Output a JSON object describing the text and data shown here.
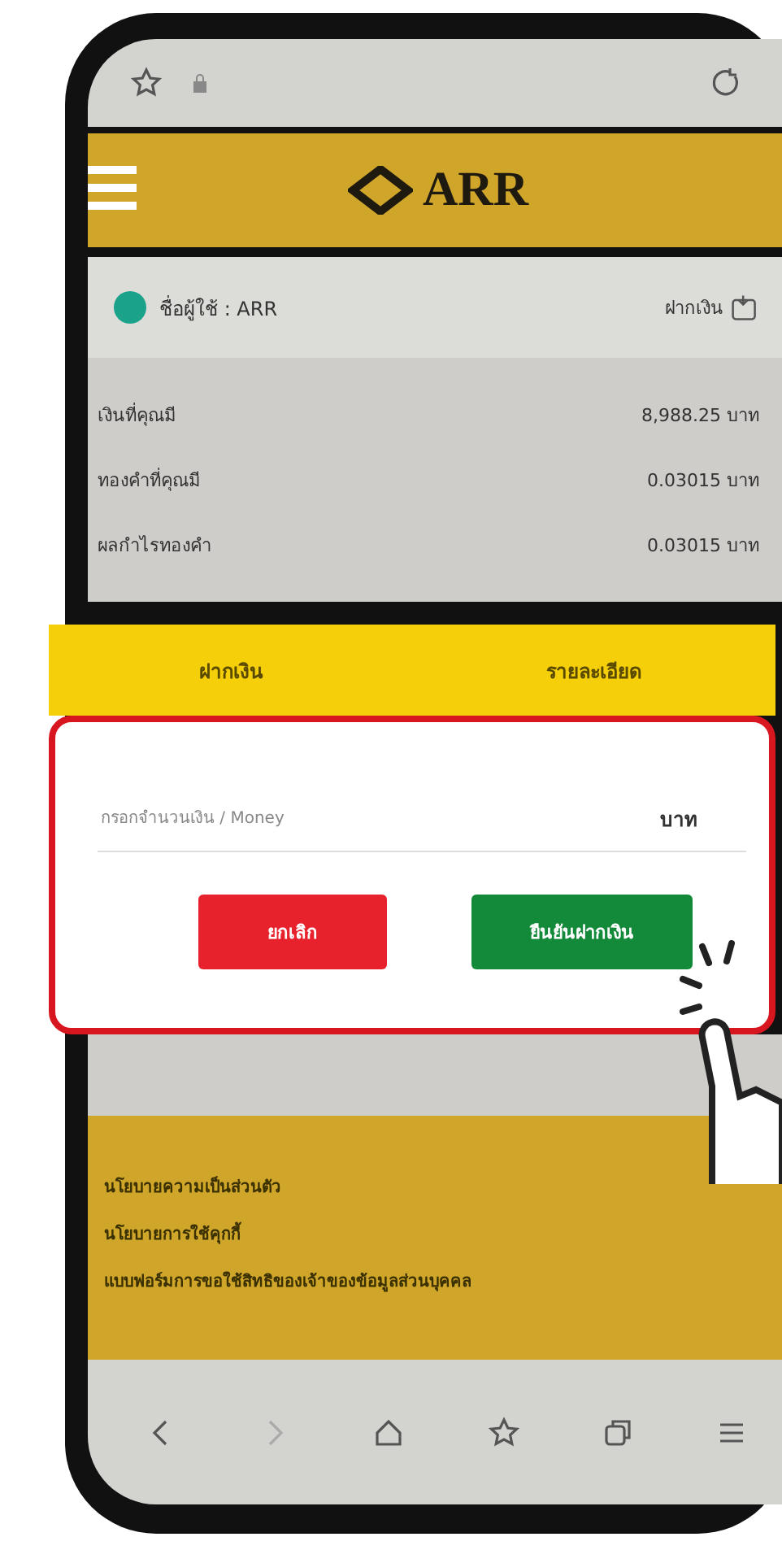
{
  "header": {
    "logo": "ARR"
  },
  "user": {
    "label": "ชื่อผู้ใช้ : ARR",
    "deposit_link": "ฝากเงิน"
  },
  "balances": [
    {
      "label": "เงินที่คุณมี",
      "value": "8,988.25 บาท"
    },
    {
      "label": "ทองคำที่คุณมี",
      "value": "0.03015 บาท"
    },
    {
      "label": "ผลกำไรทองคำ",
      "value": "0.03015 บาท"
    }
  ],
  "tabs": [
    {
      "label": "ฝากเงิน"
    },
    {
      "label": "รายละเอียด"
    }
  ],
  "amount_field": {
    "placeholder": "กรอกจำนวนเงิน / Money",
    "unit": "บาท"
  },
  "buttons": [
    {
      "label": "ยกเลิก",
      "kind": "cancel"
    },
    {
      "label": "ยืนยันฝากเงิน",
      "kind": "confirm"
    }
  ],
  "footer_links": [
    "นโยบายความเป็นส่วนตัว",
    "นโยบายการใช้คุกกี้",
    "แบบฟอร์มการขอใช้สิทธิของเจ้าของข้อมูลส่วนบุคคล"
  ]
}
